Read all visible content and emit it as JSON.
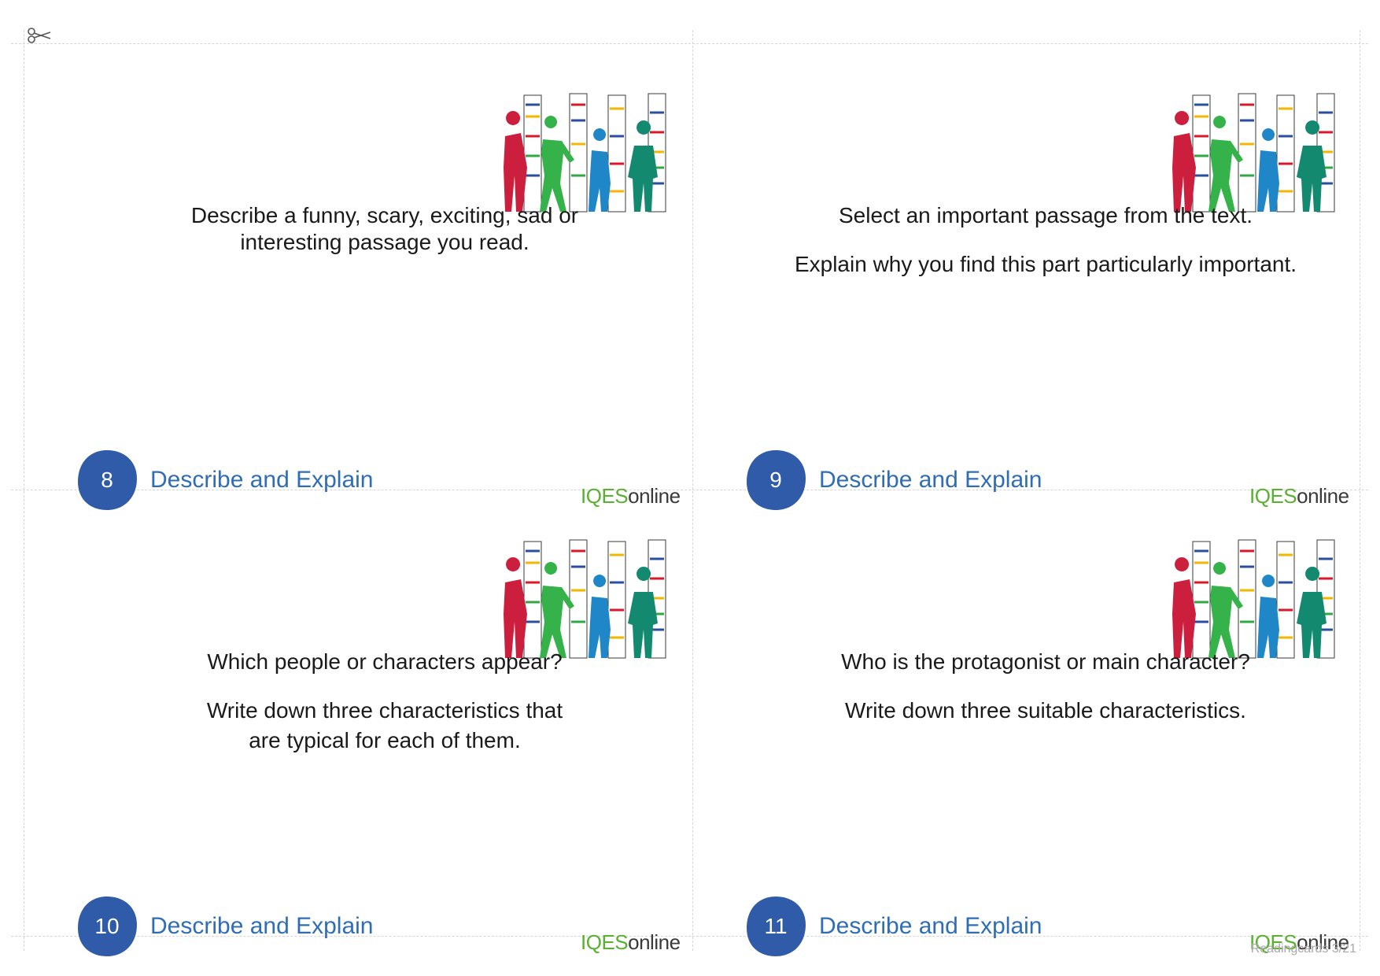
{
  "colors": {
    "badge": "#2f5ba8",
    "category": "#2f6db5",
    "brand_green": "#5ab031",
    "brand_dark": "#3a3a3a",
    "cut_line": "#d6d6d6"
  },
  "cards": [
    {
      "number": "8",
      "category": "Describe and Explain",
      "paragraphs": [
        "Describe a funny, scary, exciting, sad or",
        "interesting passage you read."
      ],
      "brand": {
        "part1": "IQES",
        "part2": "online"
      }
    },
    {
      "number": "9",
      "category": "Describe and Explain",
      "paragraphs": [
        "Select an important passage from the text.",
        "Explain why you find this part particularly important."
      ],
      "brand": {
        "part1": "IQES",
        "part2": "online"
      }
    },
    {
      "number": "10",
      "category": "Describe and Explain",
      "paragraphs": [
        "Which people or characters appear?",
        "Write down three characteristics that",
        "are typical for each of them."
      ],
      "brand": {
        "part1": "IQES",
        "part2": "online"
      }
    },
    {
      "number": "11",
      "category": "Describe and Explain",
      "paragraphs": [
        "Who is the protagonist or main character?",
        "Write down three suitable characteristics."
      ],
      "brand": {
        "part1": "IQES",
        "part2": "online"
      }
    }
  ],
  "footer": "Readingcards 3/21",
  "icons": {
    "scissors": "scissors-icon",
    "illustration": "people-book-stacks-illustration"
  }
}
